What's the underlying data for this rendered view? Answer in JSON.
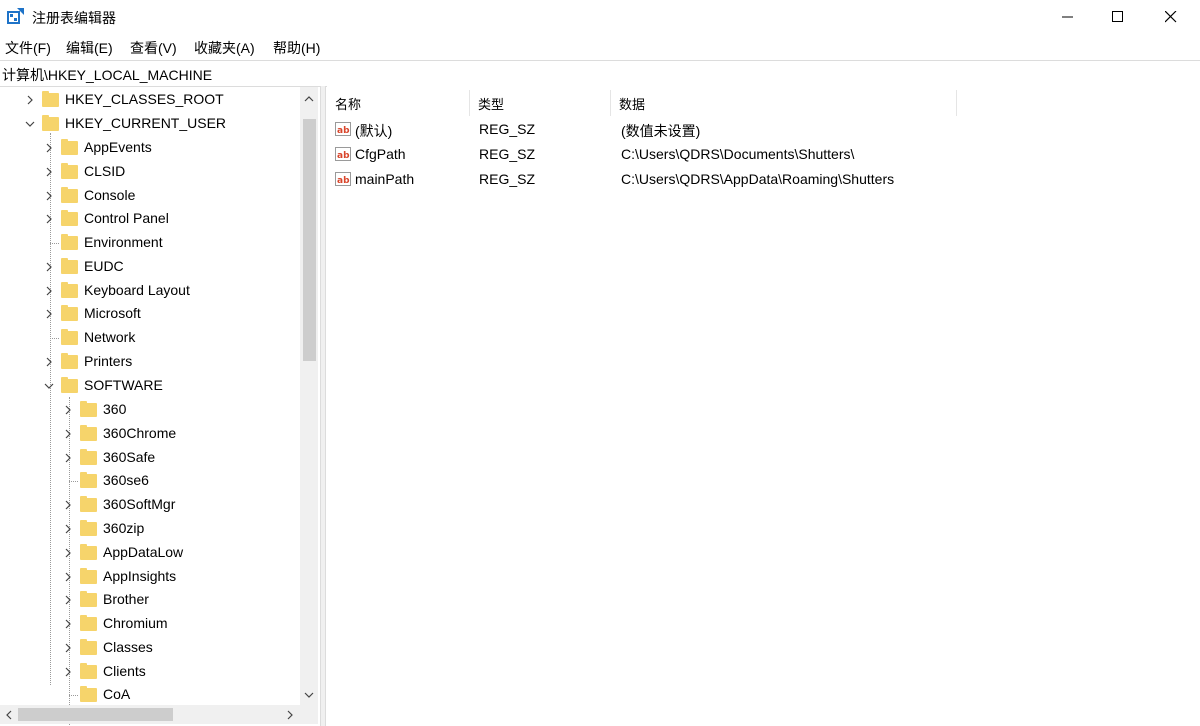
{
  "window": {
    "title": "注册表编辑器"
  },
  "menu": [
    "文件(F)",
    "编辑(E)",
    "查看(V)",
    "收藏夹(A)",
    "帮助(H)"
  ],
  "address": "计算机\\HKEY_LOCAL_MACHINE",
  "tree": {
    "roots": [
      "HKEY_CLASSES_ROOT",
      "HKEY_CURRENT_USER"
    ],
    "hkcu_children": [
      "AppEvents",
      "CLSID",
      "Console",
      "Control Panel",
      "Environment",
      "EUDC",
      "Keyboard Layout",
      "Microsoft",
      "Network",
      "Printers",
      "SOFTWARE"
    ],
    "software_children": [
      "360",
      "360Chrome",
      "360Safe",
      "360se6",
      "360SoftMgr",
      "360zip",
      "AppDataLow",
      "AppInsights",
      "Brother",
      "Chromium",
      "Classes",
      "Clients",
      "CoA"
    ]
  },
  "columns": {
    "name": "名称",
    "type": "类型",
    "data": "数据"
  },
  "values": [
    {
      "name": "(默认)",
      "type": "REG_SZ",
      "data": "(数值未设置)"
    },
    {
      "name": "CfgPath",
      "type": "REG_SZ",
      "data": "C:\\Users\\QDRS\\Documents\\Shutters\\"
    },
    {
      "name": "mainPath",
      "type": "REG_SZ",
      "data": "C:\\Users\\QDRS\\AppData\\Roaming\\Shutters"
    }
  ],
  "icons": {
    "app": "regedit-icon",
    "value": "reg-sz-icon",
    "folder": "folder-icon"
  },
  "colors": {
    "folder": "#f6d46b",
    "value_icon": "#d9452b"
  }
}
